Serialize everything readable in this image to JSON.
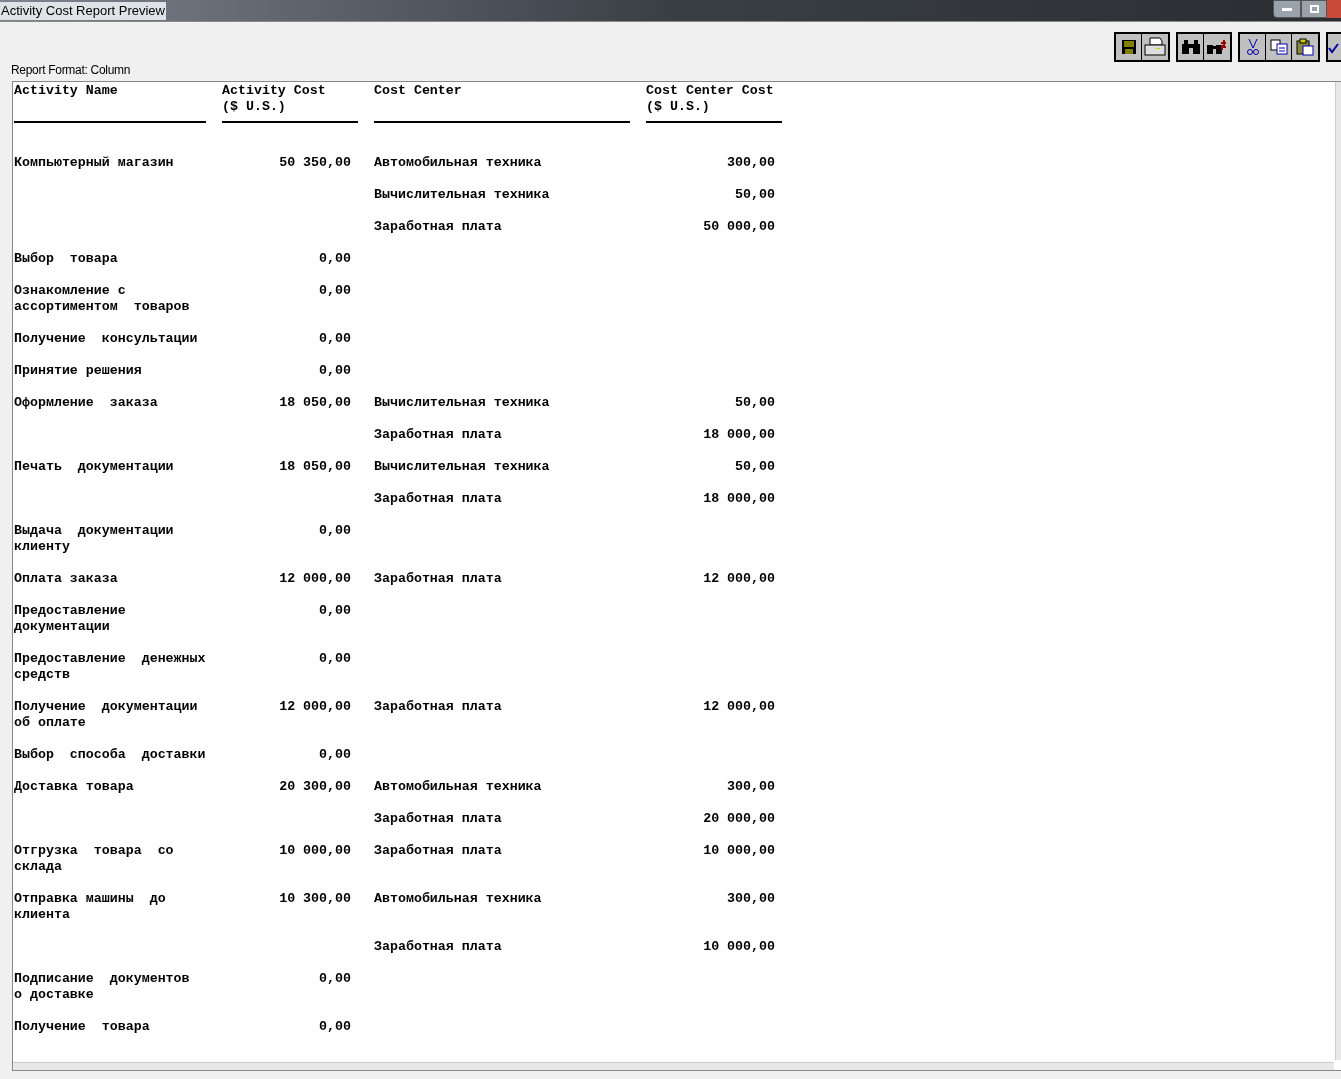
{
  "window": {
    "title": "Activity Cost Report Preview"
  },
  "report_format": "Report Format: Column",
  "columns": [
    "Activity Name",
    "Activity Cost\n($ U.S.)",
    "Cost Center",
    "Cost Center Cost\n($ U.S.)"
  ],
  "rows": [
    {
      "name": "Компьютерный магазин",
      "cost": "50 350,00",
      "centers": [
        {
          "name": "Автомобильная техника",
          "cost": "300,00"
        },
        {
          "name": "Вычислительная техника",
          "cost": "50,00"
        },
        {
          "name": "Заработная плата",
          "cost": "50 000,00"
        }
      ]
    },
    {
      "name": "Выбор  товара",
      "cost": "0,00",
      "centers": []
    },
    {
      "name": "Ознакомление с\nассортиментом  товаров",
      "cost": "0,00",
      "centers": []
    },
    {
      "name": "Получение  консультации",
      "cost": "0,00",
      "centers": []
    },
    {
      "name": "Принятие решения",
      "cost": "0,00",
      "centers": []
    },
    {
      "name": "Оформление  заказа",
      "cost": "18 050,00",
      "centers": [
        {
          "name": "Вычислительная техника",
          "cost": "50,00"
        },
        {
          "name": "Заработная плата",
          "cost": "18 000,00"
        }
      ]
    },
    {
      "name": "Печать  документации",
      "cost": "18 050,00",
      "centers": [
        {
          "name": "Вычислительная техника",
          "cost": "50,00"
        },
        {
          "name": "Заработная плата",
          "cost": "18 000,00"
        }
      ]
    },
    {
      "name": "Выдача  документации\nклиенту",
      "cost": "0,00",
      "centers": []
    },
    {
      "name": "Оплата заказа",
      "cost": "12 000,00",
      "centers": [
        {
          "name": "Заработная плата",
          "cost": "12 000,00"
        }
      ]
    },
    {
      "name": "Предоставление\nдокументации",
      "cost": "0,00",
      "centers": []
    },
    {
      "name": "Предоставление  денежных\nсредств",
      "cost": "0,00",
      "centers": []
    },
    {
      "name": "Получение  документации\nоб оплате",
      "cost": "12 000,00",
      "centers": [
        {
          "name": "Заработная плата",
          "cost": "12 000,00"
        }
      ]
    },
    {
      "name": "Выбор  способа  доставки",
      "cost": "0,00",
      "centers": []
    },
    {
      "name": "Доставка товара",
      "cost": "20 300,00",
      "centers": [
        {
          "name": "Автомобильная техника",
          "cost": "300,00"
        },
        {
          "name": "Заработная плата",
          "cost": "20 000,00"
        }
      ]
    },
    {
      "name": "Отгрузка  товара  со\nсклада",
      "cost": "10 000,00",
      "centers": [
        {
          "name": "Заработная плата",
          "cost": "10 000,00"
        }
      ]
    },
    {
      "name": "Отправка машины  до\nклиента",
      "cost": "10 300,00",
      "centers": [
        {
          "name": "Автомобильная техника",
          "cost": "300,00"
        },
        {
          "name": "Заработная плата",
          "cost": "10 000,00"
        }
      ]
    },
    {
      "name": "Подписание  документов\nо доставке",
      "cost": "0,00",
      "centers": []
    },
    {
      "name": "Получение  товара",
      "cost": "0,00",
      "centers": []
    }
  ]
}
